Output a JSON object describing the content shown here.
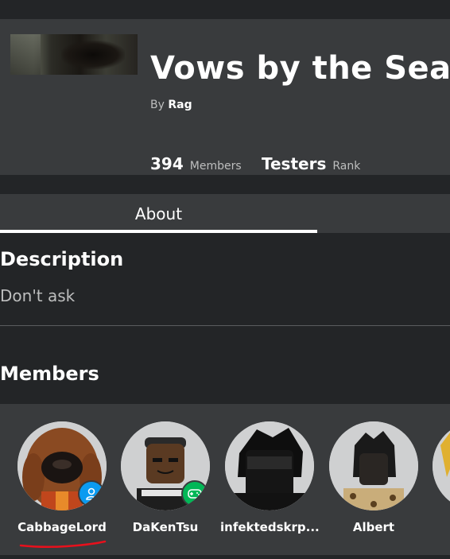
{
  "group": {
    "title": "Vows by the Sea",
    "by_label": "By",
    "owner": "Rag",
    "members_count": "394",
    "members_label": "Members",
    "rank_value": "Testers",
    "rank_label": "Rank"
  },
  "tabs": [
    {
      "label": "About"
    }
  ],
  "about": {
    "description_heading": "Description",
    "description_text": "Don't ask",
    "members_heading": "Members"
  },
  "members": [
    {
      "name": "CabbageLord",
      "badge_icon": "user-icon",
      "badge_color": "#0b9bf0"
    },
    {
      "name": "DaKenTsu",
      "badge_icon": "gamepad-icon",
      "badge_color": "#02b757"
    },
    {
      "name": "infektedskrp..."
    },
    {
      "name": "Albert"
    }
  ],
  "colors": {
    "page_bg": "#232527",
    "card_bg": "#393b3d",
    "annotation": "#e8101c"
  }
}
